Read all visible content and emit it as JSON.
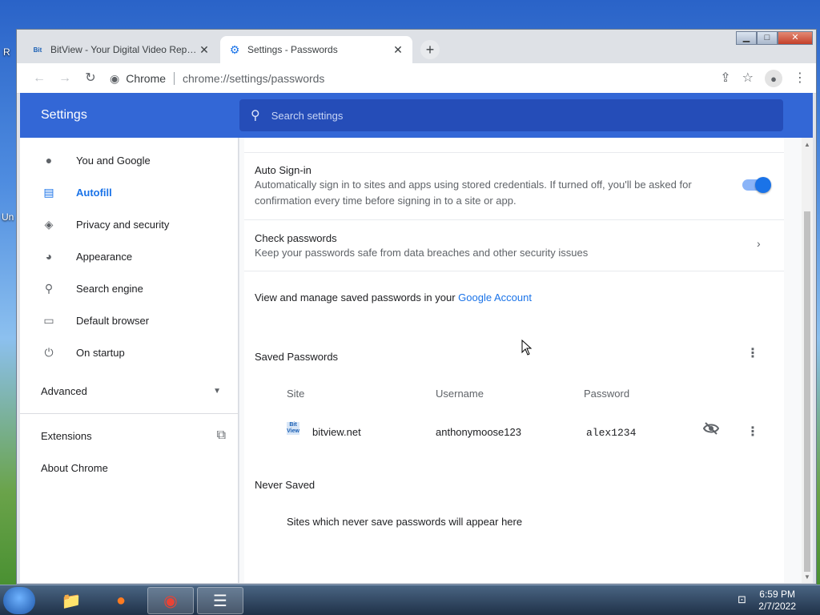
{
  "tabs": [
    {
      "favicon": "Bit",
      "title": "BitView - Your Digital Video Repository",
      "close": "✕"
    },
    {
      "favicon": "gear-icon",
      "title": "Settings - Passwords",
      "close": "✕"
    }
  ],
  "new_tab": "+",
  "omnibox": {
    "chip": "Chrome",
    "url": "chrome://settings/passwords"
  },
  "header": {
    "title": "Settings",
    "search_placeholder": "Search settings"
  },
  "sidebar": {
    "items": [
      {
        "label": "You and Google",
        "icon": "person-icon"
      },
      {
        "label": "Autofill",
        "icon": "clipboard-icon",
        "active": true
      },
      {
        "label": "Privacy and security",
        "icon": "shield-icon"
      },
      {
        "label": "Appearance",
        "icon": "palette-icon"
      },
      {
        "label": "Search engine",
        "icon": "search-icon"
      },
      {
        "label": "Default browser",
        "icon": "browser-icon"
      },
      {
        "label": "On startup",
        "icon": "power-icon"
      }
    ],
    "advanced": "Advanced",
    "extensions": "Extensions",
    "about": "About Chrome"
  },
  "auto_signin": {
    "title": "Auto Sign-in",
    "line1": "Automatically sign in to sites and apps using stored credentials. If turned off, you'll be asked for",
    "line2": "confirmation every time before signing in to a site or app.",
    "enabled": true
  },
  "check_passwords": {
    "title": "Check passwords",
    "desc": "Keep your passwords safe from data breaches and other security issues"
  },
  "manage": {
    "text": "View and manage saved passwords in your ",
    "link": "Google Account"
  },
  "saved_passwords": {
    "title": "Saved Passwords",
    "columns": [
      "Site",
      "Username",
      "Password"
    ],
    "rows": [
      {
        "favicon": "Bit View",
        "site": "bitview.net",
        "username": "anthonymoose123",
        "password": "alex1234"
      }
    ]
  },
  "never_saved": {
    "title": "Never Saved",
    "empty": "Sites which never save passwords will appear here"
  },
  "taskbar": {
    "time": "6:59 PM",
    "date": "2/7/2022"
  },
  "colors": {
    "header": "#3367d6",
    "accent": "#1a73e8"
  }
}
